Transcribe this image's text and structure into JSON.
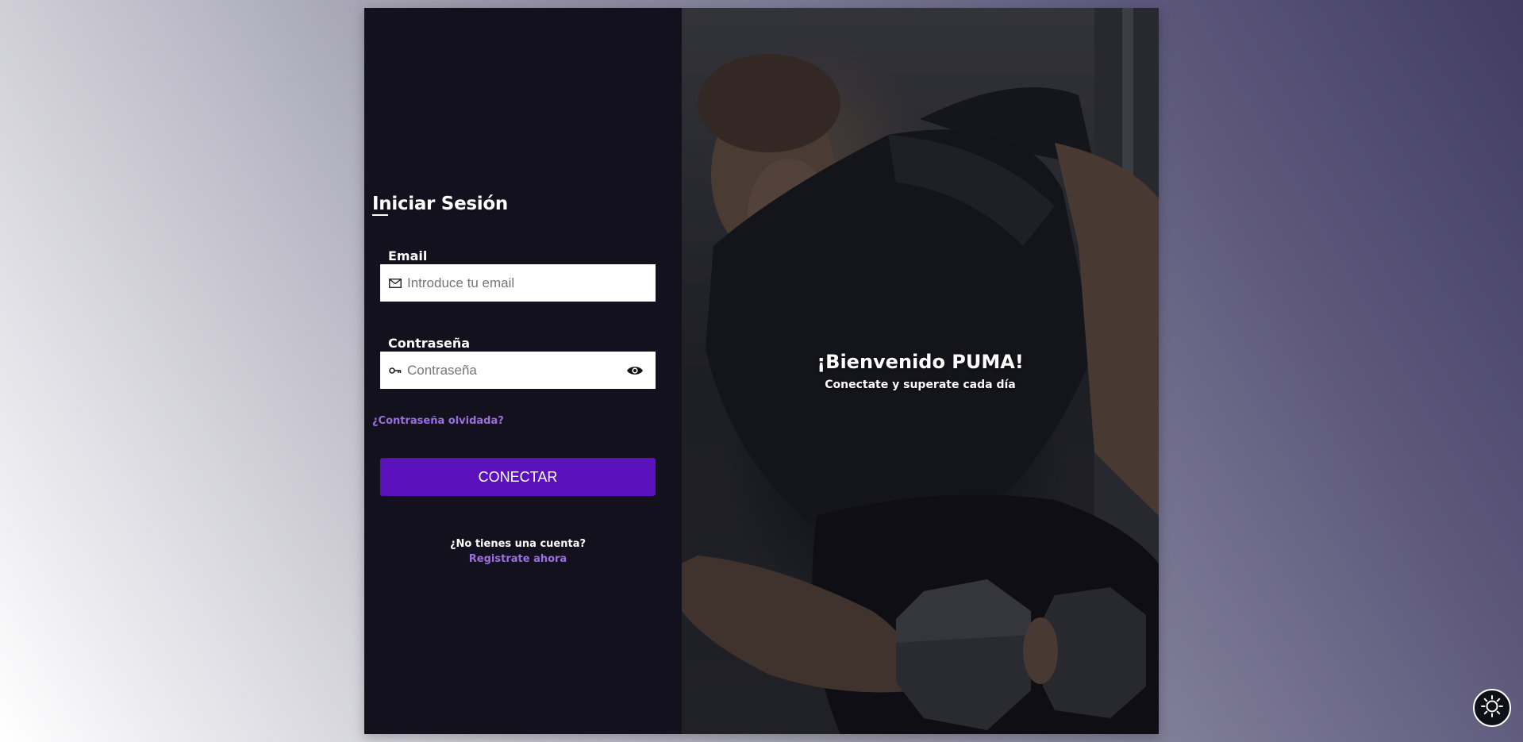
{
  "login": {
    "title": "Iniciar Sesión",
    "email_label": "Email",
    "email_placeholder": "Introduce tu email",
    "password_label": "Contraseña",
    "password_placeholder": "Contraseña",
    "forgot_link": "¿Contraseña olvidada?",
    "connect_button": "CONECTAR",
    "no_account_text": "¿No tienes una cuenta?",
    "register_link": "Registrate ahora"
  },
  "hero": {
    "welcome": "¡Bienvenido PUMA!",
    "subtitle": "Conectate y superate cada día",
    "image_description": "gym-man-lifting-dumbbell-photo"
  },
  "icons": {
    "email": "mail-icon",
    "password": "key-icon",
    "toggle_password": "eye-icon",
    "theme_toggle": "sun-icon"
  },
  "colors": {
    "panel_bg": "#12111d",
    "accent": "#5b12bd",
    "link": "#9b6fe0"
  }
}
